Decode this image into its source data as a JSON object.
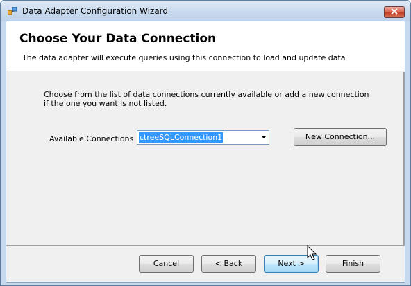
{
  "window": {
    "title": "Data Adapter Configuration Wizard"
  },
  "header": {
    "title": "Choose Your Data Connection",
    "subtitle": "The data adapter will execute queries using this connection to load and update data"
  },
  "main": {
    "instruction": "Choose from the list of data connections currently available or add a new connection if the one you want is not listed.",
    "connections_label": "Available Connections :",
    "connections_selected": "ctreeSQLConnection1",
    "new_connection_label": "New Connection..."
  },
  "footer": {
    "cancel_label": "Cancel",
    "back_label": "< Back",
    "next_label": "Next >",
    "finish_label": "Finish"
  },
  "icons": {
    "title_icon": "data-adapter-icon",
    "close_icon": "close-icon",
    "dropdown_icon": "chevron-down-icon",
    "cursor": "mouse-pointer-icon"
  },
  "colors": {
    "selection": "#3399ff",
    "close_button": "#c1391e",
    "default_button_border": "#3c7fb1"
  }
}
